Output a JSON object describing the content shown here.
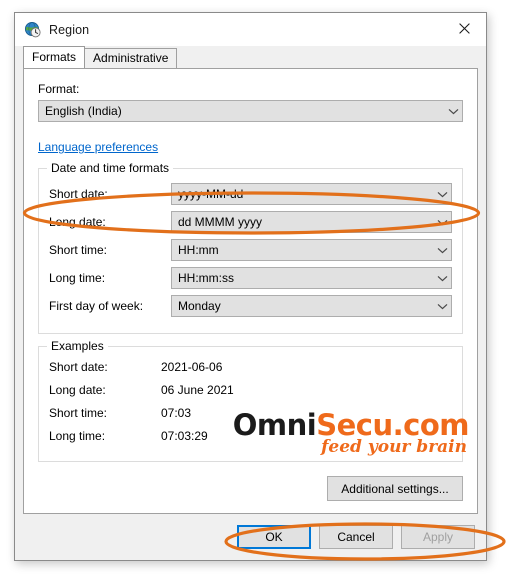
{
  "window": {
    "title": "Region",
    "icon": "region-globe-icon",
    "close_label": "×"
  },
  "tabs": [
    {
      "label": "Formats",
      "active": true
    },
    {
      "label": "Administrative",
      "active": false
    }
  ],
  "format_section": {
    "label": "Format:",
    "value": "English (India)",
    "link": "Language preferences"
  },
  "date_time_group": {
    "title": "Date and time formats",
    "rows": [
      {
        "label": "Short date:",
        "value": "yyyy-MM-dd"
      },
      {
        "label": "Long date:",
        "value": "dd MMMM yyyy"
      },
      {
        "label": "Short time:",
        "value": "HH:mm"
      },
      {
        "label": "Long time:",
        "value": "HH:mm:ss"
      },
      {
        "label": "First day of week:",
        "value": "Monday"
      }
    ]
  },
  "examples_group": {
    "title": "Examples",
    "rows": [
      {
        "label": "Short date:",
        "value": "2021-06-06"
      },
      {
        "label": "Long date:",
        "value": "06 June 2021"
      },
      {
        "label": "Short time:",
        "value": "07:03"
      },
      {
        "label": "Long time:",
        "value": "07:03:29"
      }
    ]
  },
  "watermark": {
    "name_dark": "Omni",
    "name_accent": "Secu.com",
    "tagline": "feed your brain",
    "accent_color": "#ef6a1b"
  },
  "buttons": {
    "additional_settings": "Additional settings...",
    "ok": "OK",
    "cancel": "Cancel",
    "apply": "Apply"
  },
  "annotations": {
    "color": "#e2701b",
    "highlight_short_date": "ellipse around Short date row",
    "highlight_buttons": "ellipse around OK Cancel Apply buttons"
  }
}
